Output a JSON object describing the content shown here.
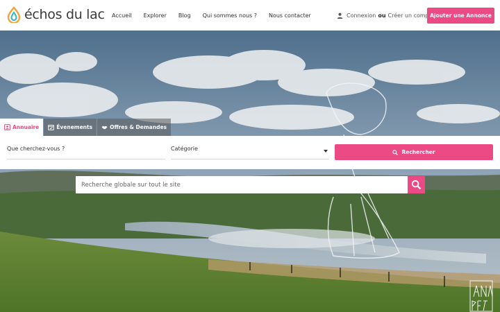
{
  "brand": {
    "name": "échos du lac",
    "logo_icon": "drop-swirl-icon",
    "colors": {
      "accent": "#ec4a84",
      "logo_orange": "#f4a23a",
      "logo_teal": "#3fb8c4"
    }
  },
  "nav": {
    "items": [
      "Accueil",
      "Explorer",
      "Blog",
      "Qui sommes nous ?",
      "Nous contacter"
    ]
  },
  "account": {
    "icon": "user-icon",
    "login": "Connexion",
    "or": "ou",
    "register": "Créer un compte"
  },
  "header_cta": {
    "label": "Ajouter une Annonce"
  },
  "tabs": [
    {
      "label": "Annuaire",
      "icon": "person-card-icon",
      "active": true
    },
    {
      "label": "Évenements",
      "icon": "calendar-check-icon",
      "active": false
    },
    {
      "label": "Offres & Demandes",
      "icon": "handshake-icon",
      "active": false
    }
  ],
  "search": {
    "what_placeholder": "Que cherchez-vous ?",
    "category_placeholder": "Catégorie",
    "button_label": "Rechercher",
    "button_icon": "search-icon"
  },
  "global_search": {
    "placeholder": "Recherche globale sur tout le site",
    "button_icon": "search-icon"
  },
  "hero": {
    "scene": "lake-landscape-with-clouds"
  }
}
